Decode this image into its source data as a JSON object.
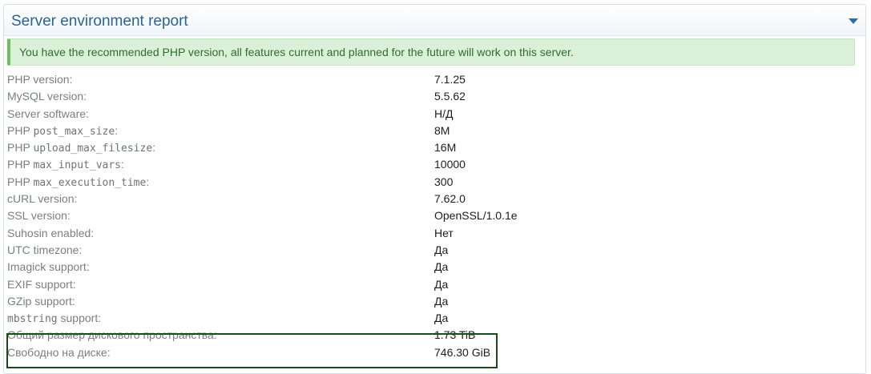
{
  "panel": {
    "title": "Server environment report",
    "collapse_icon": "chevron-down-icon"
  },
  "alert": {
    "message": "You have the recommended PHP version, all features current and planned for the future will work on this server."
  },
  "rows": [
    {
      "label_prefix": "",
      "label_code": "",
      "label": "PHP version:",
      "value": "7.1.25"
    },
    {
      "label_prefix": "",
      "label_code": "",
      "label": "MySQL version:",
      "value": "5.5.62"
    },
    {
      "label_prefix": "",
      "label_code": "",
      "label": "Server software:",
      "value": "Н/Д"
    },
    {
      "label_prefix": "PHP ",
      "label_code": "post_max_size",
      "label": ":",
      "value": "8M"
    },
    {
      "label_prefix": "PHP ",
      "label_code": "upload_max_filesize",
      "label": ":",
      "value": "16M"
    },
    {
      "label_prefix": "PHP ",
      "label_code": "max_input_vars",
      "label": ":",
      "value": "10000"
    },
    {
      "label_prefix": "PHP ",
      "label_code": "max_execution_time",
      "label": ":",
      "value": "300"
    },
    {
      "label_prefix": "",
      "label_code": "",
      "label": "cURL version:",
      "value": "7.62.0"
    },
    {
      "label_prefix": "",
      "label_code": "",
      "label": "SSL version:",
      "value": "OpenSSL/1.0.1e"
    },
    {
      "label_prefix": "",
      "label_code": "",
      "label": "Suhosin enabled:",
      "value": "Нет"
    },
    {
      "label_prefix": "",
      "label_code": "",
      "label": "UTC timezone:",
      "value": "Да"
    },
    {
      "label_prefix": "",
      "label_code": "",
      "label": "Imagick support:",
      "value": "Да"
    },
    {
      "label_prefix": "",
      "label_code": "",
      "label": "EXIF support:",
      "value": "Да"
    },
    {
      "label_prefix": "",
      "label_code": "",
      "label": "GZip support:",
      "value": "Да"
    },
    {
      "label_prefix": "",
      "label_code": "mbstring",
      "label": " support:",
      "value": "Да"
    },
    {
      "label_prefix": "",
      "label_code": "",
      "label": "Общий размер дискового пространства:",
      "value": "1.73 TiB"
    },
    {
      "label_prefix": "",
      "label_code": "",
      "label": "Свободно на диске:",
      "value": "746.30 GiB"
    }
  ],
  "colors": {
    "title": "#2a6496",
    "alert_bg": "#dbf0d9",
    "alert_text": "#2f6e2c",
    "highlight_border": "#1c4a1c"
  }
}
